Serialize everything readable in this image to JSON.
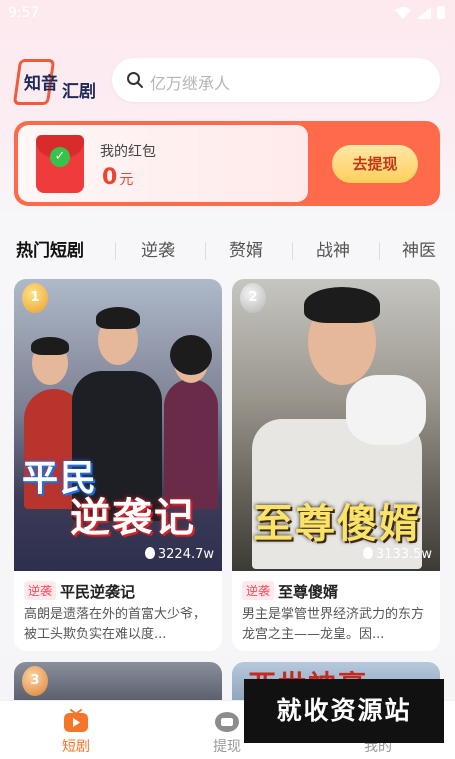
{
  "status_bar": {
    "time": "9:57"
  },
  "header": {
    "logo_text_1": "知音",
    "logo_text_2": "汇剧",
    "search_placeholder": "亿万继承人"
  },
  "red_packet": {
    "label": "我的红包",
    "amount": "0",
    "unit": "元",
    "button": "去提现"
  },
  "tabs": [
    "热门短剧",
    "逆袭",
    "赘婿",
    "战神",
    "神医"
  ],
  "active_tab": 0,
  "cards": [
    {
      "rank": "1",
      "poster_title_1": "平民",
      "poster_title_2": "逆袭记",
      "views": "3224.7w",
      "tag": "逆袭",
      "title": "平民逆袭记",
      "desc": "高朗是遗落在外的首富大少爷，被工头欺负实在难以度..."
    },
    {
      "rank": "2",
      "poster_title": "至尊傻婿",
      "views": "3133.5w",
      "tag": "逆袭",
      "title": "至尊傻婿",
      "desc": "男主是掌管世界经济武力的东方龙宫之主——龙皇。因..."
    }
  ],
  "row2": {
    "rank": "3",
    "poster_title_fragment": "亚世神豪"
  },
  "watermark": "就收资源站",
  "tab_bar": [
    {
      "label": "短剧",
      "icon": "tv-icon"
    },
    {
      "label": "提现",
      "icon": "wallet-icon"
    },
    {
      "label": "我的",
      "icon": "user-icon"
    }
  ],
  "colors": {
    "accent": "#f5762a",
    "red": "#f0432f",
    "tag_red": "#f24a5a"
  }
}
